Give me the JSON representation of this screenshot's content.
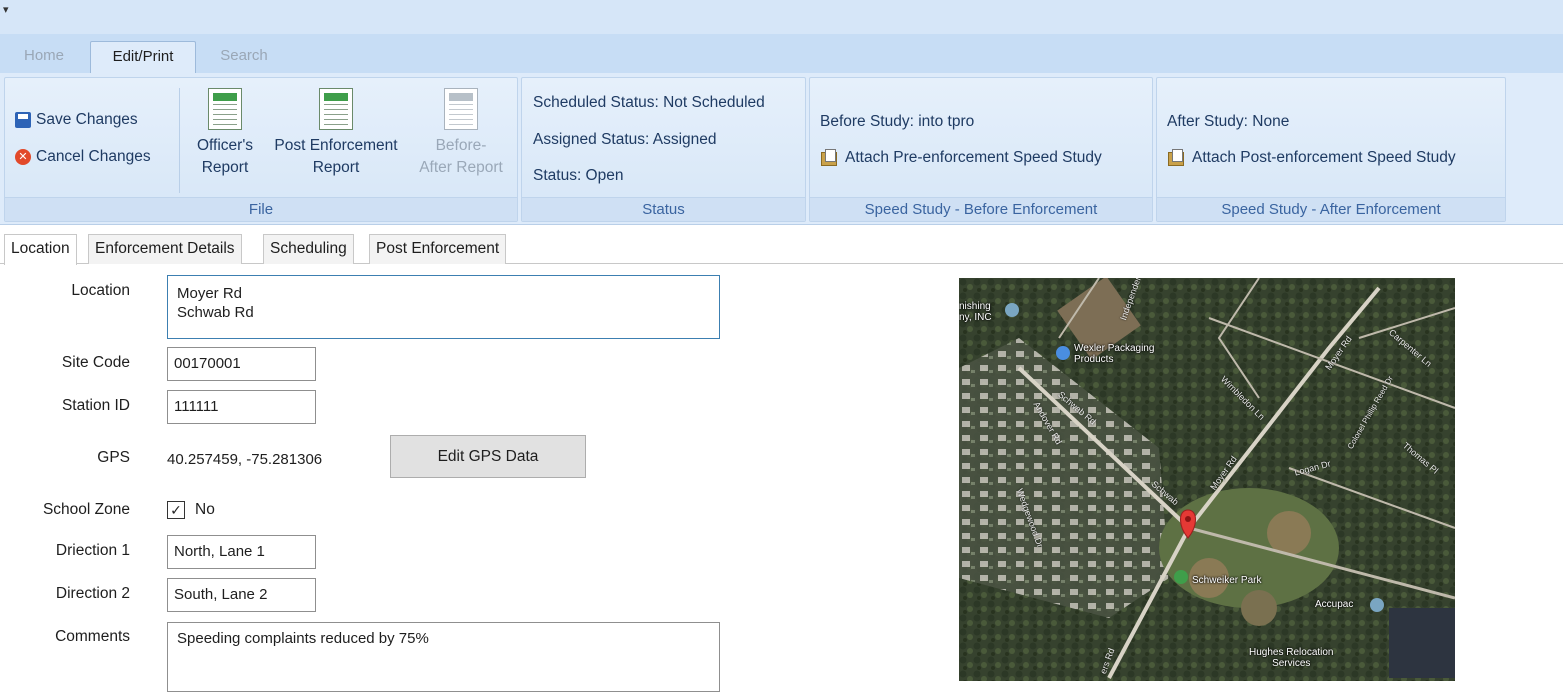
{
  "quick_access": {
    "glyph": "▾"
  },
  "ribbon_tabs": [
    {
      "label": "Home",
      "active": false
    },
    {
      "label": "Edit/Print",
      "active": true
    },
    {
      "label": "Search",
      "active": false
    }
  ],
  "file_group": {
    "save_label": "Save Changes",
    "cancel_label": "Cancel Changes",
    "officers_report": [
      "Officer's",
      "Report"
    ],
    "post_enforcement_report": [
      "Post Enforcement",
      "Report"
    ],
    "before_after_report": [
      "Before-",
      "After Report"
    ],
    "label": "File"
  },
  "status_group": {
    "scheduled": "Scheduled Status: Not Scheduled",
    "assigned": "Assigned Status: Assigned",
    "status": "Status: Open",
    "label": "Status"
  },
  "before_group": {
    "before_study": "Before Study: into tpro",
    "attach_label": "Attach Pre-enforcement Speed Study",
    "label": "Speed Study - Before Enforcement"
  },
  "after_group": {
    "after_study": "After Study: None",
    "attach_label": "Attach Post-enforcement Speed Study",
    "label": "Speed Study - After Enforcement"
  },
  "content_tabs": [
    {
      "label": "Location",
      "active": true
    },
    {
      "label": "Enforcement Details",
      "active": false
    },
    {
      "label": "Scheduling",
      "active": false
    },
    {
      "label": "Post Enforcement",
      "active": false
    }
  ],
  "form": {
    "location": {
      "label": "Location",
      "value": "Moyer Rd\nSchwab Rd"
    },
    "site_code": {
      "label": "Site Code",
      "value": "00170001"
    },
    "station_id": {
      "label": "Station ID",
      "value": "111111"
    },
    "gps": {
      "label": "GPS",
      "value": "40.257459, -75.281306",
      "button": "Edit GPS Data"
    },
    "school_zone": {
      "label": "School Zone",
      "checked": true,
      "value": "No"
    },
    "direction1": {
      "label": "Driection 1",
      "value": "North, Lane 1"
    },
    "direction2": {
      "label": "Direction 2",
      "value": "South, Lane 2"
    },
    "comments": {
      "label": "Comments",
      "value": "Speeding complaints reduced by 75%"
    }
  },
  "map": {
    "places": [
      "nishing",
      "ny, INC",
      "Wexler Packaging",
      "Products",
      "Schweiker Park",
      "Accupac",
      "Hughes Relocation",
      "Services"
    ],
    "roads": [
      "Schwab Rd",
      "Moyer Rd",
      "Schwab",
      "Moyer Rd",
      "Wimbledon Ln",
      "Andover Rd",
      "Logan Dr",
      "Carpenter Ln",
      "Thomas Pl",
      "Colonel Phillip Reed Dr",
      "Independence",
      "Wedgewood Dr",
      "ers Rd"
    ]
  },
  "colors": {
    "ribbon_bg": "#deebfa",
    "ribbon_label": "#3a64a0",
    "map_pin": "#e53935"
  }
}
